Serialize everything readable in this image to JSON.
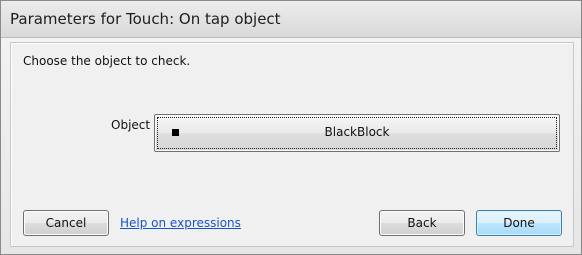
{
  "window": {
    "title": "Parameters for Touch: On tap object"
  },
  "dialog": {
    "instruction": "Choose the object to check.",
    "object_label": "Object",
    "object_value": "BlackBlock",
    "object_icon": "black-square-icon"
  },
  "buttons": {
    "cancel": "Cancel",
    "help": "Help on expressions",
    "back": "Back",
    "done": "Done"
  },
  "colors": {
    "link": "#1a53c7",
    "default_button_border": "#3c7fb1"
  }
}
